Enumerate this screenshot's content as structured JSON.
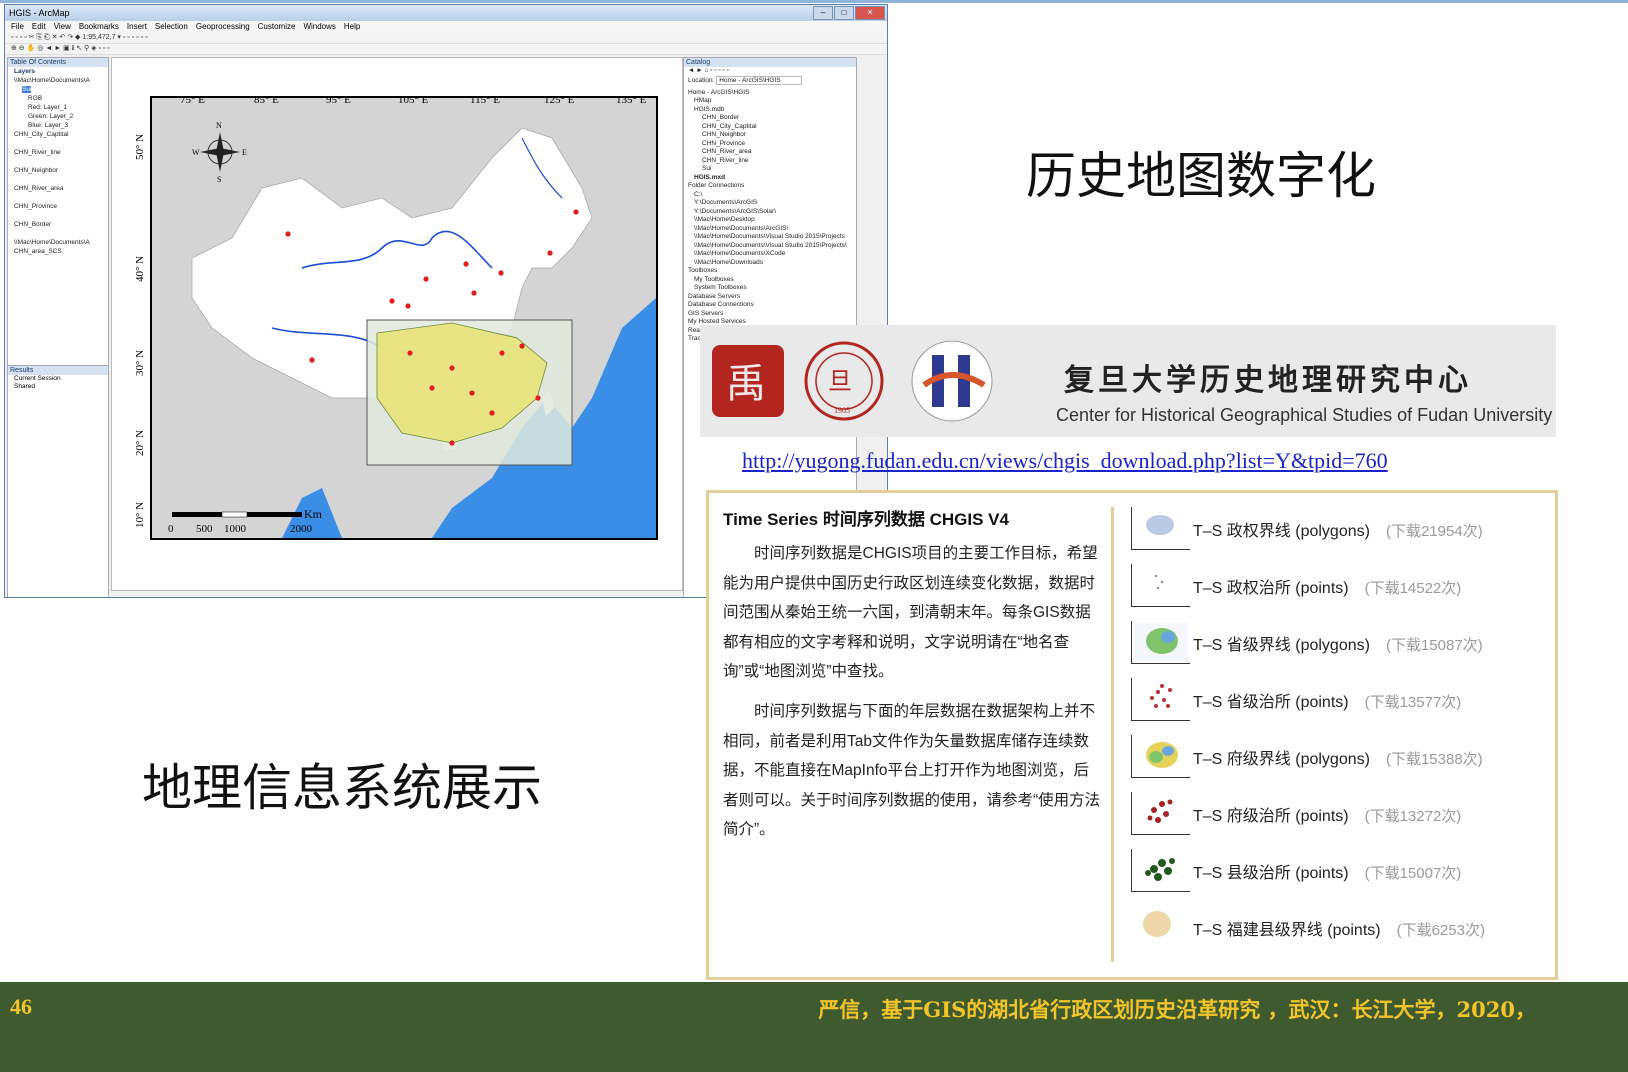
{
  "colors": {
    "accent": "#1a24c8",
    "footer_bg": "#3f5a2e",
    "footer_text": "#f4c52a",
    "panel_border": "#e2cf9a",
    "sea": "#3a8ee6"
  },
  "arcmap": {
    "title": "HGIS - ArcMap",
    "menu": [
      "File",
      "Edit",
      "View",
      "Bookmarks",
      "Insert",
      "Selection",
      "Geoprocessing",
      "Customize",
      "Windows",
      "Help"
    ],
    "scale": "1:95,472,7",
    "toc_header": "Table Of Contents",
    "toc_items": [
      "Layers",
      "\\\\Mac\\Home\\Documents\\A",
      "Sui",
      "RGB",
      "Red:   Layer_1",
      "Green: Layer_2",
      "Blue:  Layer_3",
      "CHN_City_Captital",
      "CHN_River_line",
      "CHN_Neighbor",
      "CHN_River_area",
      "CHN_Province",
      "CHN_Border",
      "\\\\Mac\\Home\\Documents\\A",
      "CHN_area_SCS"
    ],
    "results_header": "Results",
    "results_items": [
      "Current Session",
      "Shared"
    ],
    "catalog_header": "Catalog",
    "location_label": "Location:",
    "location_value": "Home - ArcGIS\\HGIS",
    "catalog_items": [
      "Home - ArcGIS\\HGIS",
      "HMap",
      "HGIS.mdb",
      "CHN_Border",
      "CHN_City_Captital",
      "CHN_Neighbor",
      "CHN_Province",
      "CHN_River_area",
      "CHN_River_line",
      "Sui",
      "HGIS.mxd",
      "Folder Connections",
      "C:\\",
      "Y:\\Documents\\ArcGIS",
      "Y:\\Documents\\ArcGIS\\Solar\\",
      "\\\\Mac\\Home\\Desktop",
      "\\\\Mac\\Home\\Documents\\ArcGIS\\",
      "\\\\Mac\\Home\\Documents\\Visual Studio 2015\\Projects",
      "\\\\Mac\\Home\\Documents\\Visual Studio 2015\\Projects\\",
      "\\\\Mac\\Home\\Documents\\XCode",
      "\\\\Mac\\Home\\Downloads",
      "Toolboxes",
      "My Toolboxes",
      "System Toolboxes",
      "Database Servers",
      "Database Connections",
      "GIS Servers",
      "My Hosted Services",
      "Rea...",
      "Trac..."
    ],
    "map": {
      "lon_labels": [
        "75° E",
        "85° E",
        "95° E",
        "105° E",
        "115° E",
        "125° E",
        "135° E"
      ],
      "lat_labels": [
        "50° N",
        "40° N",
        "30° N",
        "20° N",
        "10° N"
      ],
      "compass": [
        "N",
        "S",
        "E",
        "W"
      ],
      "scale_ticks": [
        "0",
        "500",
        "1000",
        "2000"
      ],
      "scale_unit": "Km"
    }
  },
  "titles": {
    "right": "历史地图数字化",
    "left": "地理信息系统展示"
  },
  "banner": {
    "cn": "复旦大学历史地理研究中心",
    "en": "Center for Historical Geographical Studies of Fudan University",
    "seal_text": "FUDAN UNIVERSITY",
    "seal_year": "1905"
  },
  "url": "http://yugong.fudan.edu.cn/views/chgis_download.php?list=Y&tpid=760",
  "panel": {
    "title": "Time Series 时间序列数据 CHGIS V4",
    "para1": "时间序列数据是CHGIS项目的主要工作目标，希望能为用户提供中国历史行政区划连续变化数据，数据时间范围从秦始王统一六国，到清朝末年。每条GIS数据都有相应的文字考释和说明，文字说明请在“地名查询”或“地图浏览”中查找。",
    "para2": "时间序列数据与下面的年层数据在数据架构上并不相同，前者是利用Tab文件作为矢量数据库储存连续数据，不能直接在MapInfo平台上打开作为地图浏览，后者则可以。关于时间序列数据的使用，请参考“使用方法简介”。",
    "downloads": [
      {
        "label": "T–S 政权界线 (polygons)",
        "count": "(下载21954次)",
        "color": "#b9c9e6"
      },
      {
        "label": "T–S 政权治所 (points)",
        "count": "(下载14522次)",
        "color": "#888888"
      },
      {
        "label": "T–S 省级界线 (polygons)",
        "count": "(下载15087次)",
        "color": "#7fc36b"
      },
      {
        "label": "T–S 省级治所 (points)",
        "count": "(下载13577次)",
        "color": "#b8323a"
      },
      {
        "label": "T–S 府级界线 (polygons)",
        "count": "(下载15388次)",
        "color": "#e6d35a"
      },
      {
        "label": "T–S 府级治所 (points)",
        "count": "(下载13272次)",
        "color": "#a32424"
      },
      {
        "label": "T–S 县级治所 (points)",
        "count": "(下载15007次)",
        "color": "#1f5a1a"
      },
      {
        "label": "T–S 福建县级界线 (points)",
        "count": "(下载6253次)",
        "color": "#efd7ab"
      }
    ]
  },
  "footer": {
    "page": "46",
    "citation": "严信，基于GIS的湖北省行政区划历史沿革研究 ，武汉：长江大学，2020，"
  }
}
